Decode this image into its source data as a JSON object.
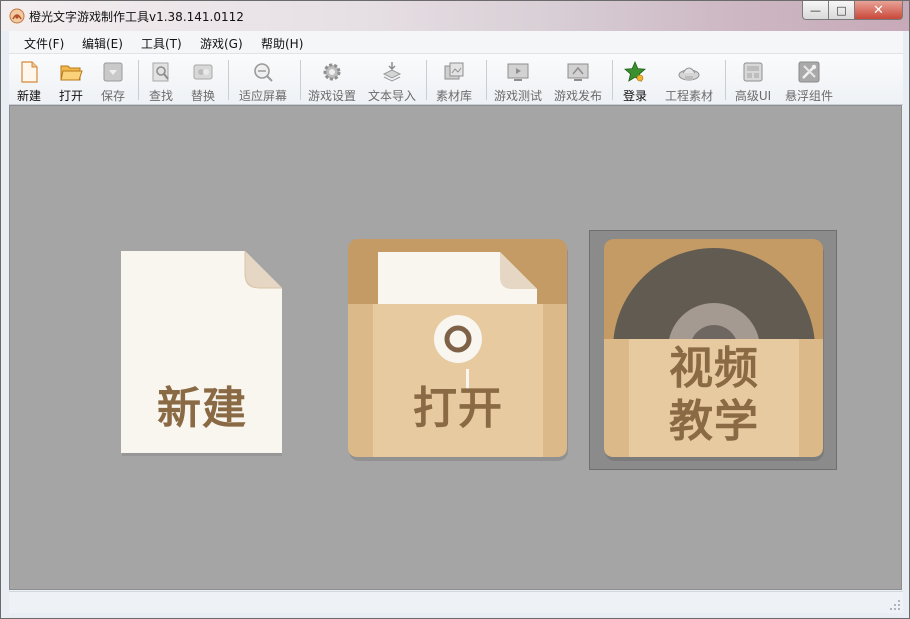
{
  "window": {
    "title": "橙光文字游戏制作工具v1.38.141.0112"
  },
  "window_buttons": {
    "minimize": "—",
    "maximize": "□",
    "close": "✕"
  },
  "menu": [
    {
      "label": "文件(F)"
    },
    {
      "label": "编辑(E)"
    },
    {
      "label": "工具(T)"
    },
    {
      "label": "游戏(G)"
    },
    {
      "label": "帮助(H)"
    }
  ],
  "toolbar": [
    {
      "label": "新建",
      "icon": "new-file-icon",
      "enabled": true
    },
    {
      "label": "打开",
      "icon": "open-folder-icon",
      "enabled": true
    },
    {
      "label": "保存",
      "icon": "save-icon",
      "enabled": false
    },
    {
      "label": "查找",
      "icon": "find-icon",
      "enabled": false
    },
    {
      "label": "替换",
      "icon": "replace-icon",
      "enabled": false
    },
    {
      "label": "适应屏幕",
      "icon": "fit-screen-icon",
      "enabled": false
    },
    {
      "label": "游戏设置",
      "icon": "gear-icon",
      "enabled": false
    },
    {
      "label": "文本导入",
      "icon": "text-import-icon",
      "enabled": false
    },
    {
      "label": "素材库",
      "icon": "asset-library-icon",
      "enabled": false
    },
    {
      "label": "游戏测试",
      "icon": "game-test-icon",
      "enabled": false
    },
    {
      "label": "游戏发布",
      "icon": "game-publish-icon",
      "enabled": false
    },
    {
      "label": "登录",
      "icon": "login-star-icon",
      "enabled": true
    },
    {
      "label": "工程素材",
      "icon": "project-assets-icon",
      "enabled": false
    },
    {
      "label": "高级UI",
      "icon": "advanced-ui-icon",
      "enabled": false
    },
    {
      "label": "悬浮组件",
      "icon": "floating-widget-icon",
      "enabled": false
    }
  ],
  "cards": {
    "new": "新建",
    "open": "打开",
    "video_line1": "视频",
    "video_line2": "教学"
  },
  "colors": {
    "canvas": "#a5a5a5",
    "card_paper": "#f8f6ef",
    "card_tan": "#d9b888",
    "card_text": "#8a6a45"
  }
}
